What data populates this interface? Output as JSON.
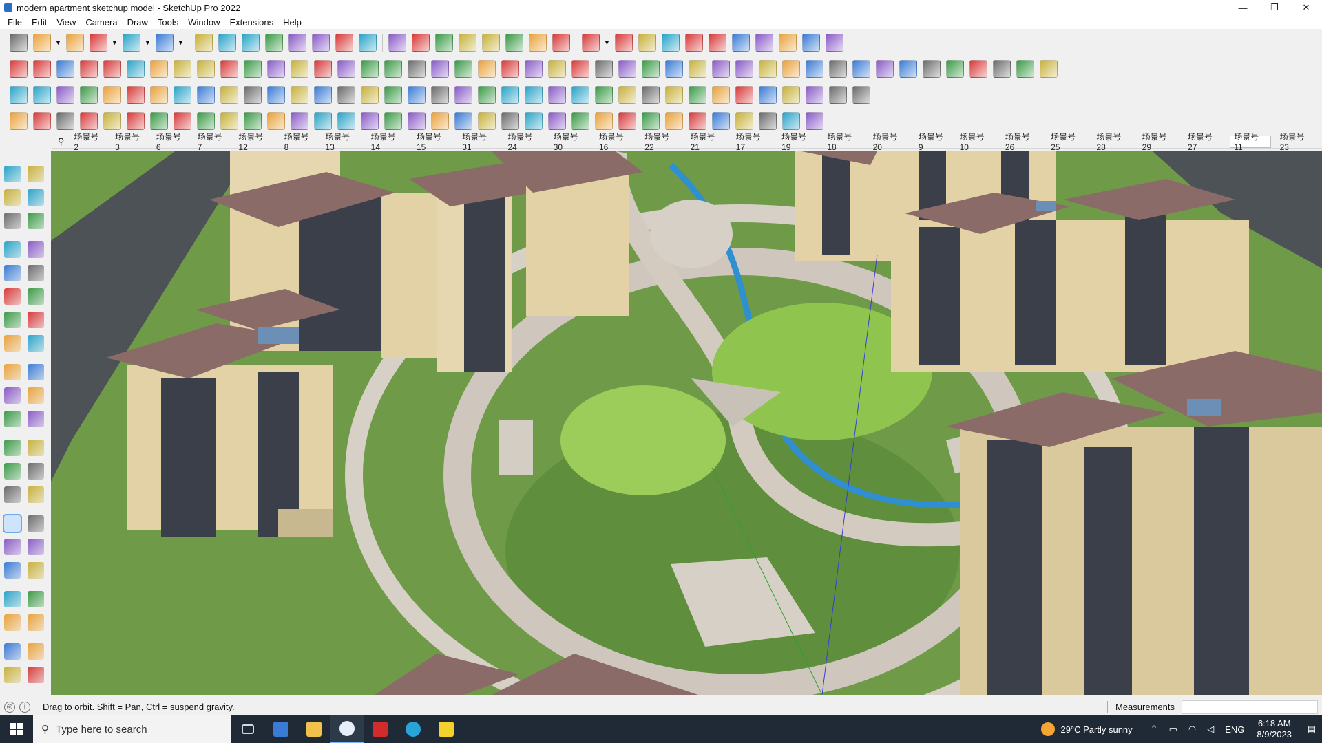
{
  "window": {
    "title": "modern apartment sketchup model - SketchUp Pro 2022",
    "controls": {
      "minimize": "—",
      "maximize": "❐",
      "close": "✕"
    }
  },
  "menu": [
    "File",
    "Edit",
    "View",
    "Camera",
    "Draw",
    "Tools",
    "Window",
    "Extensions",
    "Help"
  ],
  "toolbars": {
    "row1": [
      "search-icon",
      "select-icon",
      "dropdown-icon",
      "eraser-icon",
      "pencil-icon",
      "dropdown-icon",
      "shape-icon",
      "dropdown-icon",
      "paint-icon",
      "dropdown-icon",
      "pushpull-icon",
      "followme-icon",
      "move-icon",
      "rotate-icon",
      "scale-icon",
      "tape-icon",
      "text-icon",
      "paint-bucket-icon",
      "orbit-icon",
      "pan-icon",
      "zoom-icon",
      "zoom-extents-icon",
      "sandbox-icon",
      "sandbox2-icon",
      "sandbox3-icon",
      "sandbox4-icon",
      "section-icon",
      "dropdown-icon",
      "component-icon",
      "material-icon",
      "axis-icon",
      "updown-icon",
      "updown2-icon",
      "dimension-icon",
      "protractor-icon",
      "undo-icon",
      "redo-icon",
      "ruby-icon"
    ],
    "row2": [
      "cube-icon",
      "cube2-icon",
      "cube3-icon",
      "arrow-red-icon",
      "view-top-icon",
      "view-front-icon",
      "view-right-icon",
      "view-back-icon",
      "view-left-icon",
      "view-iso-icon",
      "view-bottom-icon",
      "xray-icon",
      "shaded-icon",
      "wire-icon",
      "hidden-icon",
      "texture-icon",
      "mono-icon",
      "house-icon",
      "house2-icon",
      "house3-icon",
      "house4-icon",
      "house5-icon",
      "fx-icon",
      "hand-icon",
      "pencil2-icon",
      "circle-icon",
      "circle2-icon",
      "circle3-icon",
      "ellipse-icon",
      "parallelogram-icon",
      "arc-icon",
      "lasso-icon",
      "bezier-icon",
      "poly-icon",
      "poly2-icon",
      "line-red-icon",
      "eraser2-icon",
      "brush-icon",
      "grid-icon",
      "pyramid-icon",
      "stamp-icon",
      "face-icon",
      "shell-icon",
      "box-icon",
      "box2-icon"
    ],
    "row3": [
      "layer-icon",
      "layer2-icon",
      "layer3-icon",
      "layer4-icon",
      "layer5-icon",
      "layer6-icon",
      "loop-icon",
      "square-red-icon",
      "list-icon",
      "page-icon",
      "tool-icon",
      "pipe-icon",
      "curve-icon",
      "plus-red-icon",
      "plus-green-icon",
      "cross-blue-icon",
      "cone-icon",
      "warn-icon",
      "ring-icon",
      "ring2-icon",
      "ring3-icon",
      "move2-icon",
      "cube-red-icon",
      "magnet-icon",
      "qr-icon",
      "plugin-icon",
      "plugin2-icon",
      "plugin3-icon",
      "cube-small-icon",
      "cube-small2-icon",
      "grid2-icon",
      "grid3-icon",
      "grid4-icon",
      "grid5-icon",
      "dots-icon",
      "lasso2-icon",
      "grid6-icon"
    ],
    "row4": [
      "line-icon",
      "path-icon",
      "snake-icon",
      "knife-icon",
      "gear-icon",
      "spring-icon",
      "dome-icon",
      "globe-icon",
      "gear2-icon",
      "beam-icon",
      "beam2-icon",
      "beam3-icon",
      "ramp-icon",
      "stair-icon",
      "stair2-icon",
      "stair3-icon",
      "stair4-icon",
      "wall-icon",
      "roof-icon",
      "roof2-icon",
      "roof3-icon",
      "roof4-icon",
      "roof5-icon",
      "roof6-icon",
      "roof7-icon",
      "roof8-icon",
      "roof9-icon",
      "roof10-icon",
      "roof11-icon",
      "roof12-icon",
      "roof13-icon",
      "roof14-icon",
      "roof15-icon",
      "roof16-icon",
      "roof17-icon"
    ]
  },
  "scenes": {
    "search_glyph": "⚲",
    "active": "场景号11",
    "tabs": [
      "场景号2",
      "场景号3",
      "场景号6",
      "场景号7",
      "场景号12",
      "场景号8",
      "场景号13",
      "场景号14",
      "场景号15",
      "场景号31",
      "场景号24",
      "场景号30",
      "场景号16",
      "场景号22",
      "场景号21",
      "场景号17",
      "场景号19",
      "场景号18",
      "场景号20",
      "场景号9",
      "场景号10",
      "场景号26",
      "场景号25",
      "场景号28",
      "场景号29",
      "场景号27",
      "场景号11",
      "场景号23"
    ]
  },
  "palette": {
    "active": "orbit-tool-icon",
    "rows": [
      [
        "select-tool-icon",
        "orbit-select-icon"
      ],
      [
        "paint-tool-icon",
        "eraser-tool-icon"
      ],
      [
        "component-tool-icon",
        "tag-tool-icon"
      ],
      [
        "sep"
      ],
      [
        "line-tool-icon",
        "freehand-tool-icon"
      ],
      [
        "rectangle-tool-icon",
        "rotated-rect-icon"
      ],
      [
        "circle-tool-icon",
        "polygon-tool-icon"
      ],
      [
        "arc-tool-icon",
        "arc2-tool-icon"
      ],
      [
        "arc3-tool-icon",
        "pie-tool-icon"
      ],
      [
        "sep"
      ],
      [
        "move-tool-icon",
        "pushpull-tool-icon"
      ],
      [
        "rotate-tool-icon",
        "followme-tool-icon"
      ],
      [
        "scale-tool-icon",
        "offset-tool-icon"
      ],
      [
        "sep"
      ],
      [
        "tape-tool-icon",
        "dimension-tool-icon"
      ],
      [
        "protractor-tool-icon",
        "text-tool-icon"
      ],
      [
        "axes-tool-icon",
        "3dtext-tool-icon"
      ],
      [
        "sep"
      ],
      [
        "orbit-tool-icon",
        "pan-tool-icon"
      ],
      [
        "zoom-tool-icon",
        "zoom-window-icon"
      ],
      [
        "zoom-extents-tool-icon",
        "prev-view-icon"
      ],
      [
        "sep"
      ],
      [
        "position-camera-icon",
        "look-around-icon"
      ],
      [
        "walk-tool-icon",
        "section-plane-icon"
      ],
      [
        "sep"
      ],
      [
        "sandbox-tool-icon",
        "sandbox-scratch-icon"
      ],
      [
        "sandbox-smoove-icon",
        "sandbox-stamp-icon"
      ]
    ]
  },
  "status": {
    "hint": "Drag to orbit. Shift = Pan, Ctrl = suspend gravity.",
    "measurements_label": "Measurements",
    "measurements_value": ""
  },
  "taskbar": {
    "search_placeholder": "Type here to search",
    "weather": "29°C  Partly sunny",
    "language": "ENG",
    "time": "6:18 AM",
    "date": "8/9/2023"
  },
  "colors": {
    "accent": "#2b6cc4",
    "grass": "#6e9a4a",
    "taskbar": "#1f2a36"
  }
}
